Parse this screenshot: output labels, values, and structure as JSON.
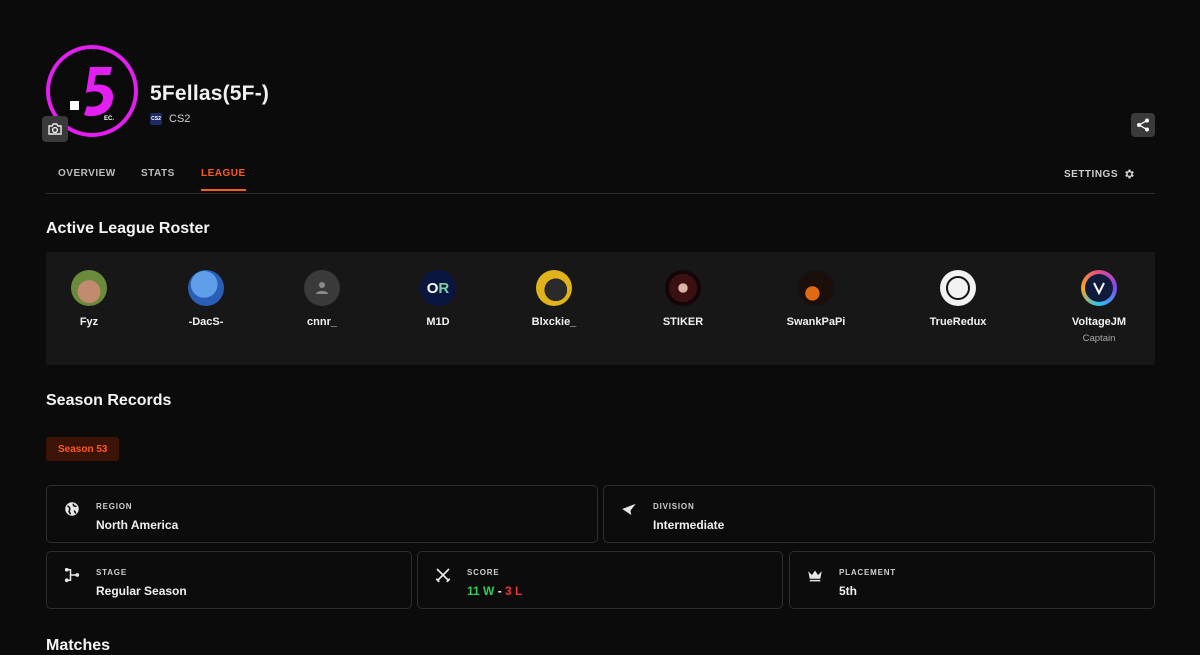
{
  "team": {
    "name": "5Fellas(5F-)",
    "game": "CS2",
    "game_icon_text": "CS2",
    "logo_text": "5",
    "logo_subtext": "EC."
  },
  "tabs": [
    {
      "label": "OVERVIEW"
    },
    {
      "label": "STATS"
    },
    {
      "label": "LEAGUE"
    }
  ],
  "active_tab": "LEAGUE",
  "settings_label": "SETTINGS",
  "roster": {
    "title": "Active League Roster",
    "players": [
      {
        "name": "Fyz",
        "role": ""
      },
      {
        "name": "-DacS-",
        "role": ""
      },
      {
        "name": "cnnr_",
        "role": ""
      },
      {
        "name": "M1D",
        "role": ""
      },
      {
        "name": "Blxckie_",
        "role": ""
      },
      {
        "name": "STIKER",
        "role": ""
      },
      {
        "name": "SwankPaPi",
        "role": ""
      },
      {
        "name": "TrueRedux",
        "role": ""
      },
      {
        "name": "VoltageJM",
        "role": "Captain"
      }
    ]
  },
  "season": {
    "title": "Season Records",
    "badge": "Season 53",
    "region": {
      "label": "REGION",
      "value": "North America"
    },
    "division": {
      "label": "DIVISION",
      "value": "Intermediate"
    },
    "stage": {
      "label": "STAGE",
      "value": "Regular Season"
    },
    "score": {
      "label": "SCORE",
      "wins": "11 W",
      "separator": "-",
      "losses": "3 L"
    },
    "placement": {
      "label": "PLACEMENT",
      "value": "5th"
    }
  },
  "matches_title": "Matches",
  "colors": {
    "accent": "#ff5a1f",
    "logo_ring": "#e21ef0",
    "win": "#36c95b",
    "loss": "#ef3333"
  }
}
